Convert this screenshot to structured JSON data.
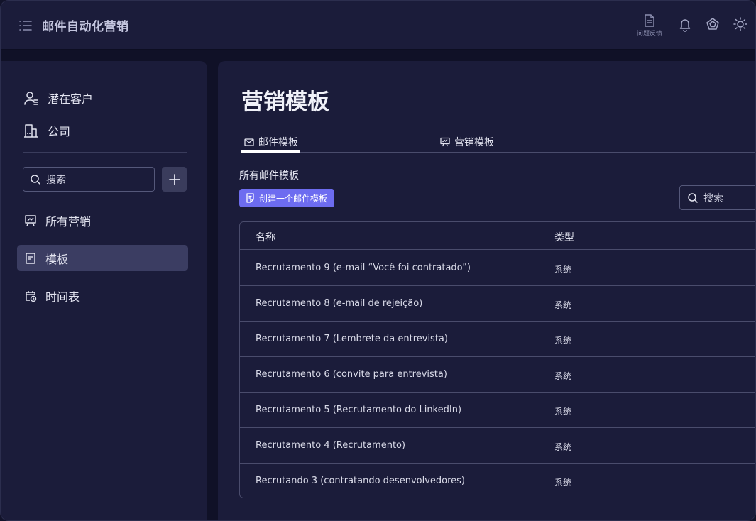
{
  "header": {
    "app_title": "邮件自动化营销",
    "feedback_label": "问题反馈",
    "icons": [
      "menu-icon",
      "document-icon",
      "bell-icon",
      "pentagon-icon",
      "sun-icon"
    ]
  },
  "sidebar": {
    "top_items": [
      {
        "label": "潜在客户",
        "icon": "user-list-icon"
      },
      {
        "label": "公司",
        "icon": "building-icon"
      }
    ],
    "search_placeholder": "搜索",
    "add_label": "+",
    "nav_items": [
      {
        "label": "所有营销",
        "icon": "presentation-icon",
        "active": false
      },
      {
        "label": "模板",
        "icon": "document-icon",
        "active": true
      },
      {
        "label": "时间表",
        "icon": "calendar-clock-icon",
        "active": false
      }
    ]
  },
  "main": {
    "title": "营销模板",
    "tabs": [
      {
        "label": "邮件模板",
        "icon": "mail-icon",
        "active": true
      },
      {
        "label": "营销模板",
        "icon": "presentation-icon",
        "active": false
      }
    ],
    "section_title": "所有邮件模板",
    "create_button": "创建一个邮件模板",
    "search_placeholder": "搜索",
    "table": {
      "columns": [
        "名称",
        "类型"
      ],
      "rows": [
        {
          "name": "Recrutamento 9 (e-mail “Você foi contratado”)",
          "type": "系统"
        },
        {
          "name": "Recrutamento 8 (e-mail de rejeição)",
          "type": "系统"
        },
        {
          "name": "Recrutamento 7 (Lembrete da entrevista)",
          "type": "系统"
        },
        {
          "name": "Recrutamento 6 (convite para entrevista)",
          "type": "系统"
        },
        {
          "name": "Recrutamento 5 (Recrutamento do LinkedIn)",
          "type": "系统"
        },
        {
          "name": "Recrutamento 4 (Recrutamento)",
          "type": "系统"
        },
        {
          "name": "Recrutando 3 (contratando desenvolvedores)",
          "type": "系统"
        }
      ]
    }
  },
  "colors": {
    "background": "#101127",
    "panel": "#1b1c3a",
    "active_nav": "#3b3d62",
    "accent_button": "#6d6cf0",
    "border": "#4a4c6c"
  }
}
